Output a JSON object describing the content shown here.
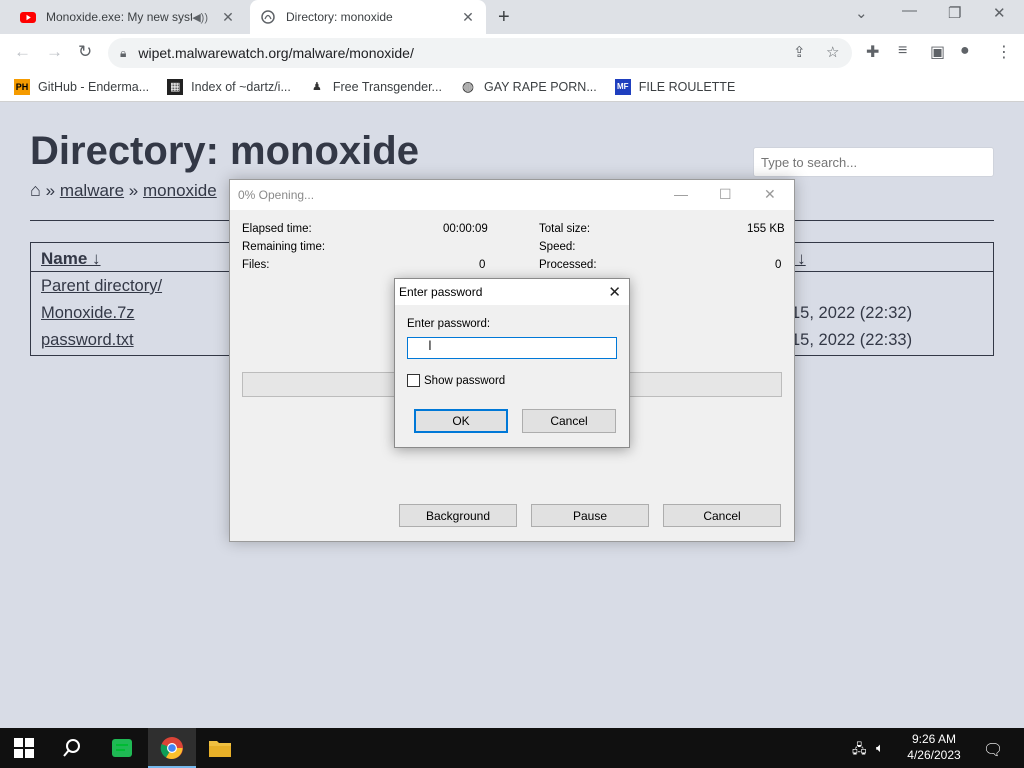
{
  "browser": {
    "tabs": [
      {
        "title": "Monoxide.exe: My new syst",
        "active": false,
        "audio": true
      },
      {
        "title": "Directory: monoxide",
        "active": true
      }
    ],
    "url": "wipet.malwarewatch.org/malware/monoxide/",
    "bookmarks": [
      {
        "label": "GitHub - Enderma...",
        "icon": "PH"
      },
      {
        "label": "Index of ~dartz/i...",
        "icon": "grid"
      },
      {
        "label": "Free Transgender...",
        "icon": "person"
      },
      {
        "label": "GAY RAPE PORN...",
        "icon": "globe"
      },
      {
        "label": "FILE ROULETTE",
        "icon": "MF"
      }
    ]
  },
  "page": {
    "heading": "Directory: monoxide",
    "search_placeholder": "Type to search...",
    "breadcrumb": {
      "sep": "»",
      "items": [
        "malware",
        "monoxide"
      ]
    },
    "listing": {
      "name_header": "Name ↓",
      "date_header": "e ↓",
      "rows": [
        {
          "name": "Parent directory/",
          "date": ""
        },
        {
          "name": "Monoxide.7z",
          "date": "15, 2022 (22:32)"
        },
        {
          "name": "password.txt",
          "date": "15, 2022 (22:33)"
        }
      ]
    }
  },
  "progress_window": {
    "title": "0% Opening...",
    "left": [
      {
        "label": "Elapsed time:",
        "value": "00:00:09"
      },
      {
        "label": "Remaining time:",
        "value": ""
      },
      {
        "label": "Files:",
        "value": "0"
      }
    ],
    "right": [
      {
        "label": "Total size:",
        "value": "155 KB"
      },
      {
        "label": "Speed:",
        "value": ""
      },
      {
        "label": "Processed:",
        "value": "0"
      }
    ],
    "progress": 0,
    "buttons": {
      "background": "Background",
      "pause": "Pause",
      "cancel": "Cancel"
    }
  },
  "password_dialog": {
    "title": "Enter password",
    "label": "Enter password:",
    "value": "",
    "show_password_label": "Show password",
    "show_password_checked": false,
    "ok": "OK",
    "cancel": "Cancel"
  },
  "taskbar": {
    "time": "9:26 AM",
    "date": "4/26/2023"
  },
  "colors": {
    "accent": "#0078d7",
    "page_bg": "#d8dce6",
    "text": "#333846"
  }
}
